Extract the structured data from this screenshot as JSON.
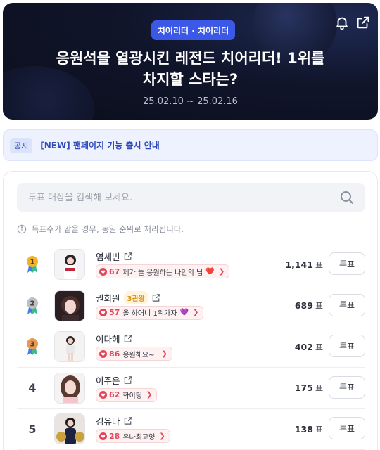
{
  "banner": {
    "category": "치어리더 · 치어리더",
    "title_line1": "응원석을 열광시킨 레전드 치어리더! 1위를",
    "title_line2": "차지할 스타는?",
    "date": "25.02.10 ~ 25.02.16",
    "icons": [
      "bell-icon",
      "share-icon"
    ]
  },
  "notice": {
    "tag": "공지",
    "text": "[NEW] 팬페이지 기능 출시 안내"
  },
  "search": {
    "placeholder": "투표 대상을 검색해 보세요."
  },
  "info": {
    "text": "득표수가 같을 경우, 동일 순위로 처리됩니다."
  },
  "ranking": [
    {
      "rank": "1",
      "name": "염세빈",
      "badge": "",
      "cheer_count": "67",
      "cheer_text": "제가 늘 응원하는 나만의 님",
      "cheer_emoji": "❤️",
      "votes": "1,141",
      "unit": "표",
      "vote_label": "투표",
      "medal_color": "#f0b429"
    },
    {
      "rank": "2",
      "name": "권희원",
      "badge": "3관왕",
      "cheer_count": "57",
      "cheer_text": "올 하어니 1위가자",
      "cheer_emoji": "💜",
      "votes": "689",
      "unit": "표",
      "vote_label": "투표",
      "medal_color": "#b8c0cc"
    },
    {
      "rank": "3",
      "name": "이다혜",
      "badge": "",
      "cheer_count": "86",
      "cheer_text": "응원해요~!",
      "cheer_emoji": "",
      "votes": "402",
      "unit": "표",
      "vote_label": "투표",
      "medal_color": "#e59a5a"
    },
    {
      "rank": "4",
      "name": "이주은",
      "badge": "",
      "cheer_count": "62",
      "cheer_text": "화이팅",
      "cheer_emoji": "",
      "votes": "175",
      "unit": "표",
      "vote_label": "투표",
      "medal_color": ""
    },
    {
      "rank": "5",
      "name": "김유나",
      "badge": "",
      "cheer_count": "28",
      "cheer_text": "유나최고양",
      "cheer_emoji": "",
      "votes": "138",
      "unit": "표",
      "vote_label": "투표",
      "medal_color": ""
    }
  ],
  "colors": {
    "accent": "#3b59e6",
    "heart": "#e2455a",
    "badge": "#d6921a"
  }
}
